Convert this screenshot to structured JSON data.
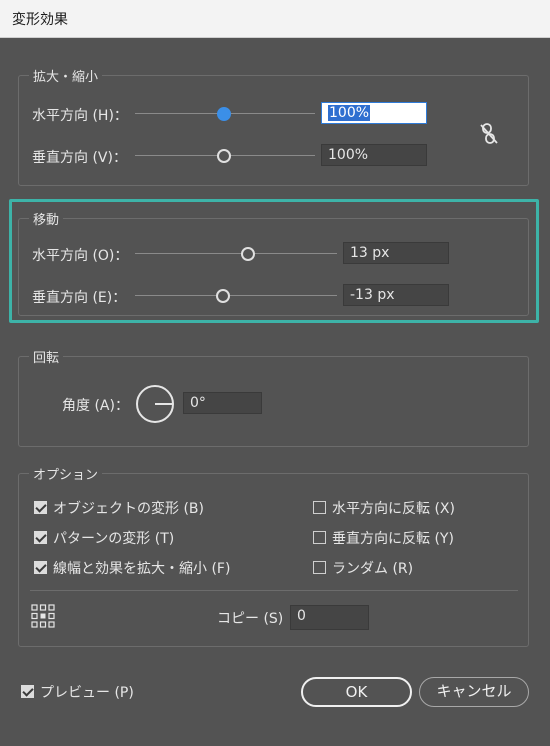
{
  "window": {
    "title": "変形効果"
  },
  "scale": {
    "legend": "拡大・縮小",
    "horizontal_label": "水平方向 (H)：",
    "horizontal_value": "100%",
    "vertical_label": "垂直方向 (V)：",
    "vertical_value": "100%"
  },
  "move": {
    "legend": "移動",
    "horizontal_label": "水平方向 (O)：",
    "horizontal_value": "13 px",
    "vertical_label": "垂直方向 (E)：",
    "vertical_value": "-13 px"
  },
  "rotate": {
    "legend": "回転",
    "angle_label": "角度 (A)：",
    "angle_value": "0°"
  },
  "options": {
    "legend": "オプション",
    "transform_objects": {
      "label": "オブジェクトの変形 (B)",
      "checked": true
    },
    "transform_patterns": {
      "label": "パターンの変形 (T)",
      "checked": true
    },
    "scale_strokes": {
      "label": "線幅と効果を拡大・縮小 (F)",
      "checked": true
    },
    "reflect_x": {
      "label": "水平方向に反転 (X)",
      "checked": false
    },
    "reflect_y": {
      "label": "垂直方向に反転 (Y)",
      "checked": false
    },
    "random": {
      "label": "ランダム (R)",
      "checked": false
    },
    "copies_label": "コピー (S)",
    "copies_value": "0"
  },
  "footer": {
    "preview_label": "プレビュー (P)",
    "preview_checked": true,
    "ok_label": "OK",
    "cancel_label": "キャンセル"
  },
  "colors": {
    "background": "#535353",
    "highlight": "#3db3a8",
    "accent": "#3b8fe8"
  }
}
